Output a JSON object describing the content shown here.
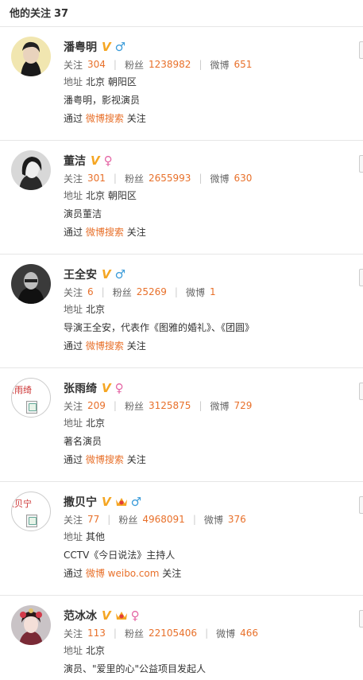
{
  "header": {
    "title": "他的关注",
    "count": "37"
  },
  "users": [
    {
      "name": "潘粤明",
      "verified": "V",
      "gender": "♂",
      "gender_type": "male",
      "crown": false,
      "follow_label": "关注",
      "follow_count": "304",
      "fans_label": "粉丝",
      "fans_count": "1238982",
      "weibo_label": "微博",
      "weibo_count": "651",
      "location_label": "地址",
      "location": "北京 朝阳区",
      "bio": "潘粤明，影视演员",
      "via_prefix": "通过",
      "via_source": "微博搜索",
      "via_suffix": "关注"
    },
    {
      "name": "董洁",
      "verified": "V",
      "gender": "♀",
      "gender_type": "female",
      "crown": false,
      "follow_label": "关注",
      "follow_count": "301",
      "fans_label": "粉丝",
      "fans_count": "2655993",
      "weibo_label": "微博",
      "weibo_count": "630",
      "location_label": "地址",
      "location": "北京 朝阳区",
      "bio": "演员董洁",
      "via_prefix": "通过",
      "via_source": "微博搜索",
      "via_suffix": "关注"
    },
    {
      "name": "王全安",
      "verified": "V",
      "gender": "♂",
      "gender_type": "male",
      "crown": false,
      "follow_label": "关注",
      "follow_count": "6",
      "fans_label": "粉丝",
      "fans_count": "25269",
      "weibo_label": "微博",
      "weibo_count": "1",
      "location_label": "地址",
      "location": "北京",
      "bio": "导演王全安，代表作《图雅的婚礼》、《团圆》",
      "via_prefix": "通过",
      "via_source": "微博搜索",
      "via_suffix": "关注"
    },
    {
      "name": "张雨绮",
      "verified": "V",
      "gender": "♀",
      "gender_type": "female",
      "crown": false,
      "avatar_alt": "张雨绮",
      "follow_label": "关注",
      "follow_count": "209",
      "fans_label": "粉丝",
      "fans_count": "3125875",
      "weibo_label": "微博",
      "weibo_count": "729",
      "location_label": "地址",
      "location": "北京",
      "bio": "著名演员",
      "via_prefix": "通过",
      "via_source": "微博搜索",
      "via_suffix": "关注"
    },
    {
      "name": "撒贝宁",
      "verified": "V",
      "gender": "♂",
      "gender_type": "male",
      "crown": true,
      "avatar_alt": "撒贝宁",
      "follow_label": "关注",
      "follow_count": "77",
      "fans_label": "粉丝",
      "fans_count": "4968091",
      "weibo_label": "微博",
      "weibo_count": "376",
      "location_label": "地址",
      "location": "其他",
      "bio": "CCTV《今日说法》主持人",
      "via_prefix": "通过",
      "via_source": "微博 weibo.com",
      "via_suffix": "关注"
    },
    {
      "name": "范冰冰",
      "verified": "V",
      "gender": "♀",
      "gender_type": "female",
      "crown": true,
      "follow_label": "关注",
      "follow_count": "113",
      "fans_label": "粉丝",
      "fans_count": "22105406",
      "weibo_label": "微博",
      "weibo_count": "466",
      "location_label": "地址",
      "location": "北京",
      "bio": "演员、\"爱里的心\"公益项目发起人"
    }
  ]
}
